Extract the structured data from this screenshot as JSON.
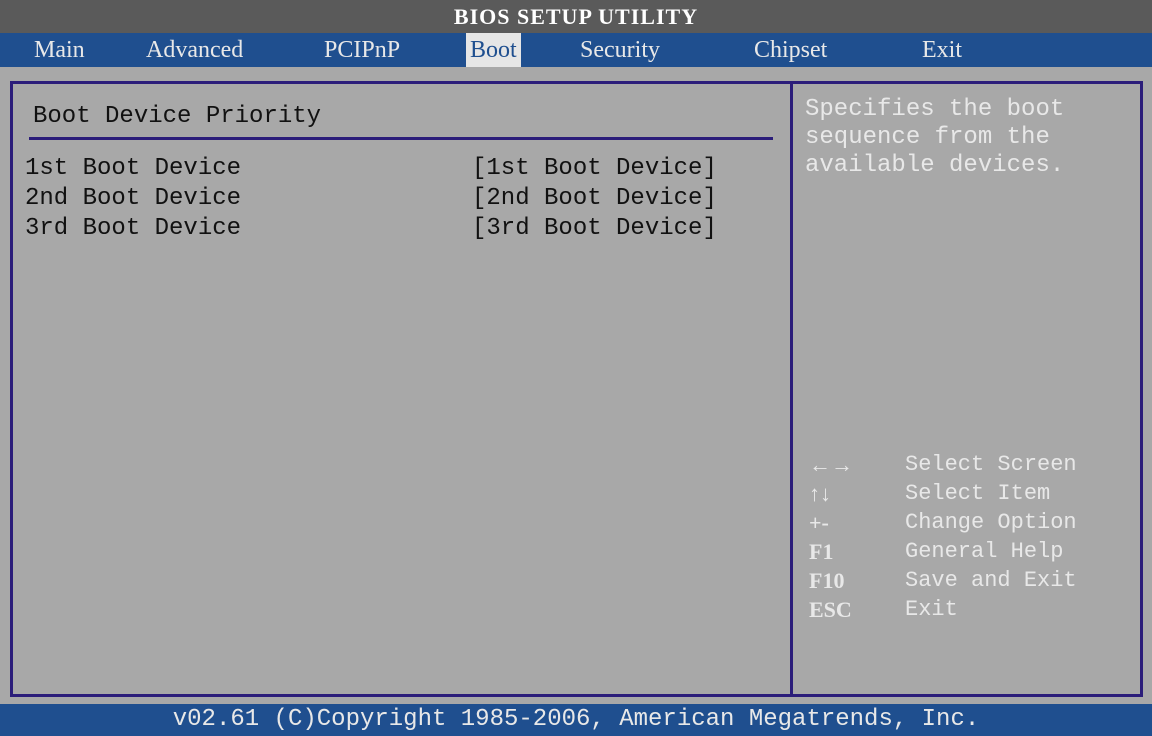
{
  "title": "BIOS SETUP UTILITY",
  "menu": {
    "items": [
      {
        "label": "Main"
      },
      {
        "label": "Advanced"
      },
      {
        "label": "PCIPnP"
      },
      {
        "label": "Boot"
      },
      {
        "label": "Security"
      },
      {
        "label": "Chipset"
      },
      {
        "label": "Exit"
      }
    ],
    "active": "Boot"
  },
  "main": {
    "section_title": "Boot Device Priority",
    "rows": [
      {
        "label": "1st Boot Device",
        "value": "[1st Boot Device]"
      },
      {
        "label": "2nd Boot Device",
        "value": "[2nd Boot Device]"
      },
      {
        "label": "3rd Boot Device",
        "value": "[3rd Boot Device]"
      }
    ]
  },
  "help": {
    "text": "Specifies the boot\nsequence from the\navailable devices.",
    "keys": [
      {
        "key": "←→",
        "desc": "Select Screen"
      },
      {
        "key": "↑↓",
        "desc": "Select Item"
      },
      {
        "key": "+-",
        "desc": "Change Option"
      },
      {
        "key": "F1",
        "desc": "General Help"
      },
      {
        "key": "F10",
        "desc": "Save and Exit"
      },
      {
        "key": "ESC",
        "desc": "Exit"
      }
    ]
  },
  "footer": "v02.61 (C)Copyright 1985-2006, American Megatrends, Inc."
}
